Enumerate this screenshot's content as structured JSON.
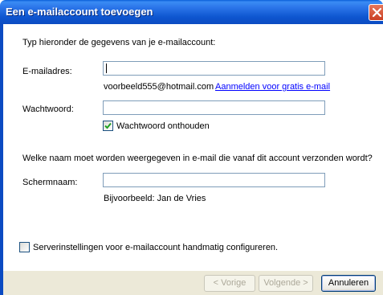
{
  "window": {
    "title": "Een e-mailaccount toevoegen",
    "close_icon": "close-icon"
  },
  "form": {
    "intro": "Typ hieronder de gegevens van je e-mailaccount:",
    "email_label": "E-mailadres:",
    "email_value": "",
    "email_example": "voorbeeld555@hotmail.com",
    "signup_link": "Aanmelden voor gratis e-mail",
    "password_label": "Wachtwoord:",
    "password_value": "",
    "remember_password_label": "Wachtwoord onthouden",
    "remember_password_checked": true,
    "display_name_question": "Welke naam moet worden weergegeven in e-mail die vanaf dit account verzonden wordt?",
    "display_name_label": "Schermnaam:",
    "display_name_value": "",
    "display_name_example": "Bijvoorbeeld: Jan de Vries",
    "manual_config_label": "Serverinstellingen voor e-mailaccount handmatig configureren.",
    "manual_config_checked": false
  },
  "buttons": {
    "back": "< Vorige",
    "next": "Volgende >",
    "cancel": "Annuleren"
  },
  "colors": {
    "titlebar": "#0b4bc2",
    "link": "#0000ff",
    "dialog_bg": "#ece9d8"
  }
}
